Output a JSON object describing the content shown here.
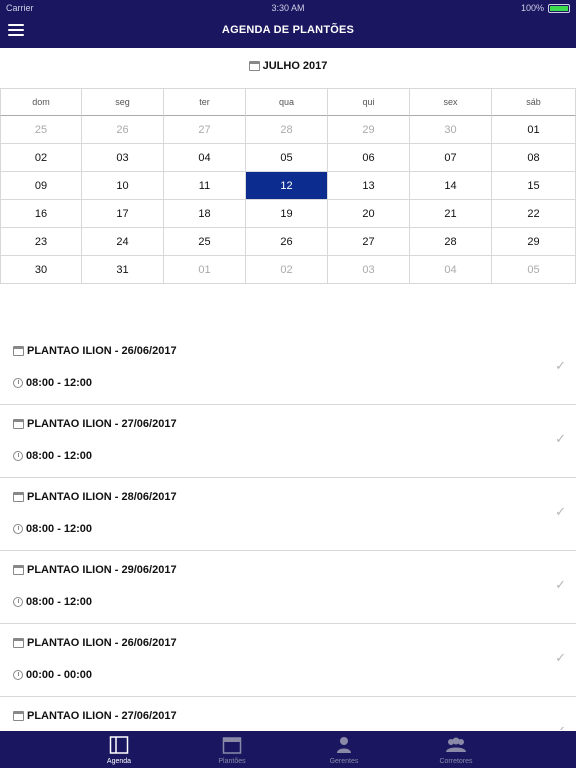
{
  "status_bar": {
    "carrier": "Carrier",
    "time": "3:30 AM",
    "battery": "100%"
  },
  "nav": {
    "title": "AGENDA DE PLANTÕES"
  },
  "calendar": {
    "month_label": "JULHO 2017",
    "weekdays": [
      "dom",
      "seg",
      "ter",
      "qua",
      "qui",
      "sex",
      "sáb"
    ],
    "weeks": [
      [
        "25",
        "26",
        "27",
        "28",
        "29",
        "30",
        "01"
      ],
      [
        "02",
        "03",
        "04",
        "05",
        "06",
        "07",
        "08"
      ],
      [
        "09",
        "10",
        "11",
        "12",
        "13",
        "14",
        "15"
      ],
      [
        "16",
        "17",
        "18",
        "19",
        "20",
        "21",
        "22"
      ],
      [
        "23",
        "24",
        "25",
        "26",
        "27",
        "28",
        "29"
      ],
      [
        "30",
        "31",
        "01",
        "02",
        "03",
        "04",
        "05"
      ]
    ],
    "selected_day": "12",
    "selected_color": "#0c2c8f"
  },
  "schedule": [
    {
      "title": "PLANTAO ILION - 26/06/2017",
      "time": "08:00 - 12:00"
    },
    {
      "title": "PLANTAO ILION - 27/06/2017",
      "time": "08:00 - 12:00"
    },
    {
      "title": "PLANTAO ILION - 28/06/2017",
      "time": "08:00 - 12:00"
    },
    {
      "title": "PLANTAO ILION - 29/06/2017",
      "time": "08:00 - 12:00"
    },
    {
      "title": "PLANTAO ILION - 26/06/2017",
      "time": "00:00 - 00:00"
    },
    {
      "title": "PLANTAO ILION - 27/06/2017",
      "time": ""
    }
  ],
  "tabs": [
    {
      "label": "Agenda",
      "icon": "book-icon",
      "active": true
    },
    {
      "label": "Plantões",
      "icon": "calendar-icon",
      "active": false
    },
    {
      "label": "Gerentes",
      "icon": "person-icon",
      "active": false
    },
    {
      "label": "Corretores",
      "icon": "group-icon",
      "active": false
    }
  ],
  "colors": {
    "nav_bg": "#1b1660",
    "accent": "#0c2c8f"
  }
}
